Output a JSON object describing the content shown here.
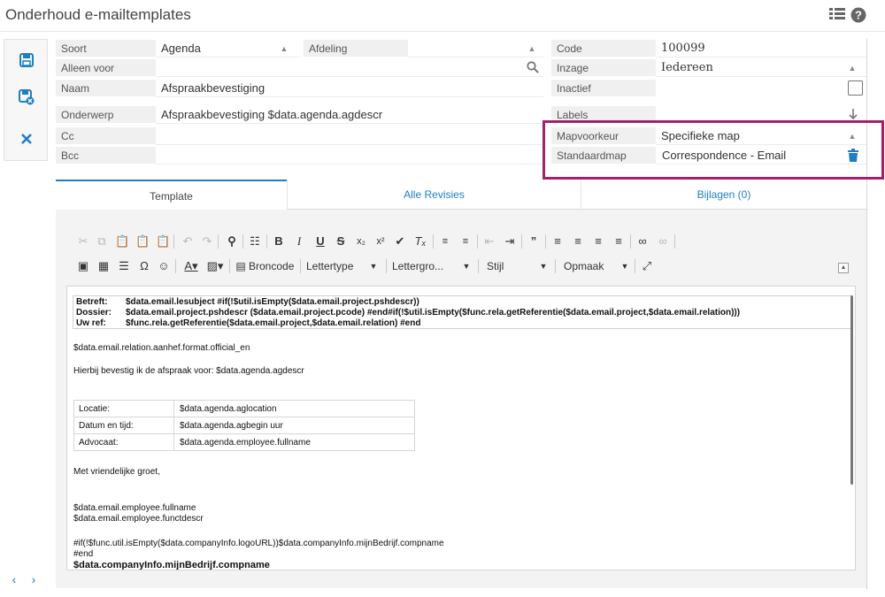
{
  "app": {
    "title": "Onderhoud e-mailtemplates",
    "icons": [
      "list-icon",
      "help-icon"
    ]
  },
  "sidebar": {
    "buttons": [
      "save-icon",
      "save-close-icon",
      "cancel-icon"
    ]
  },
  "form": {
    "soort_label": "Soort",
    "soort_value": "Agenda",
    "afdeling_label": "Afdeling",
    "afdeling_value": "",
    "code_label": "Code",
    "code_value": "100099",
    "alleen_voor_label": "Alleen voor",
    "alleen_voor_value": "",
    "inzage_label": "Inzage",
    "inzage_value": "Iedereen",
    "naam_label": "Naam",
    "naam_value": "Afspraakbevestiging",
    "inactief_label": "Inactief",
    "inactief_checked": false,
    "onderwerp_label": "Onderwerp",
    "onderwerp_value": "Afspraakbevestiging $data.agenda.agdescr",
    "labels_label": "Labels",
    "cc_label": "Cc",
    "cc_value": "",
    "bcc_label": "Bcc",
    "bcc_value": "",
    "mapvoorkeur_label": "Mapvoorkeur",
    "mapvoorkeur_value": "Specifieke map",
    "standaardmap_label": "Standaardmap",
    "standaardmap_value": "Correspondence - Email"
  },
  "tabs": {
    "template": "Template",
    "revisies": "Alle Revisies",
    "bijlagen": "Bijlagen (0)"
  },
  "toolbar": {
    "broncode": "Broncode",
    "lettertype": "Lettertype",
    "lettergrootte": "Lettergro...",
    "stijl": "Stijl",
    "opmaak": "Opmaak"
  },
  "content": {
    "header_rows": [
      {
        "label": "Betreft:",
        "value": "$data.email.lesubject #if(!$util.isEmpty($data.email.project.pshdescr))"
      },
      {
        "label": "Dossier:",
        "value": "$data.email.project.pshdescr ($data.email.project.pcode) #end#if(!$util.isEmpty($func.rela.getReferentie($data.email.project,$data.email.relation)))"
      },
      {
        "label": "Uw ref:",
        "value": "$func.rela.getReferentie($data.email.project,$data.email.relation) #end"
      }
    ],
    "aanhef": "$data.email.relation.aanhef.format.official_en",
    "intro": "Hierbij bevestig ik de afspraak voor: $data.agenda.agdescr",
    "detail_rows": [
      {
        "label": "Locatie:",
        "value": "$data.agenda.aglocation"
      },
      {
        "label": "Datum en tijd:",
        "value": "$data.agenda.agbegin uur"
      },
      {
        "label": "Advocaat:",
        "value": "$data.agenda.employee.fullname"
      }
    ],
    "groet": "Met vriendelijke groet,",
    "employee_name": "$data.email.employee.fullname",
    "employee_function": "$data.email.employee.functdescr",
    "logo_if": "#if(!$func.util.isEmpty($data.companyInfo.logoURL))$data.companyInfo.mijnBedrijf.compname",
    "logo_end": "#end",
    "company": "$data.companyInfo.mijnBedrijf.compname"
  },
  "colors": {
    "accent": "#1f7fc4",
    "highlight": "#a3206b"
  }
}
